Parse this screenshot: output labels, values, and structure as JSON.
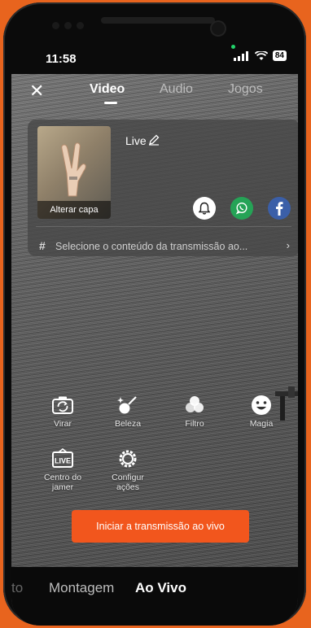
{
  "status_bar": {
    "time": "11:58",
    "battery": "84"
  },
  "tabs": [
    {
      "label": "Video",
      "active": true
    },
    {
      "label": "Audio",
      "active": false
    },
    {
      "label": "Jogos",
      "active": false
    }
  ],
  "card": {
    "cover_label": "Alterar capa",
    "title": "Live",
    "topic_placeholder": "Selecione o conteúdo da transmissão ao..."
  },
  "share_icons": [
    "bell-icon",
    "whatsapp-icon",
    "facebook-icon"
  ],
  "tools": [
    {
      "label": "Virar",
      "icon": "flip-camera-icon"
    },
    {
      "label": "Beleza",
      "icon": "beauty-wand-icon"
    },
    {
      "label": "Filtro",
      "icon": "filter-icon"
    },
    {
      "label": "Magia",
      "icon": "magic-face-icon"
    },
    {
      "label": "Centro do jamer",
      "icon": "live-center-icon"
    },
    {
      "label": "Configur ações",
      "icon": "settings-gear-icon"
    }
  ],
  "start_button": "Iniciar a transmissão ao vivo",
  "bottom_nav": {
    "left_partial": "to",
    "items": [
      {
        "label": "Montagem",
        "active": false
      },
      {
        "label": "Ao Vivo",
        "active": true
      }
    ]
  },
  "colors": {
    "accent": "#f2561d",
    "frame": "#e8641e",
    "whatsapp": "#25a356",
    "facebook": "#3b5fa8"
  }
}
